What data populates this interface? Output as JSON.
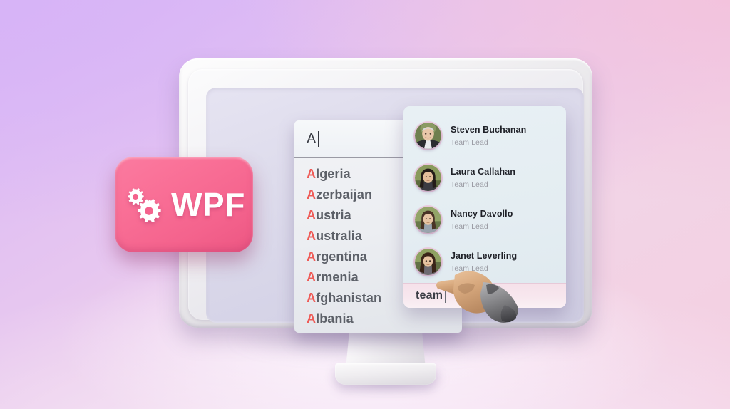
{
  "background": {
    "gradient_from": "#d9b6f6",
    "gradient_to": "#f4cfe1"
  },
  "badge": {
    "label": "WPF",
    "icon": "gears-icon",
    "color": "#f4638d",
    "text_color": "#ffffff"
  },
  "monitor": {
    "bezel_color": "#f2f1f3",
    "screen_color": "#dddbec"
  },
  "autocomplete": {
    "input": {
      "value": "A",
      "placeholder": "",
      "caret": true
    },
    "highlight_color": "#ef5b57",
    "items": [
      {
        "highlight": "A",
        "rest": "lgeria"
      },
      {
        "highlight": "A",
        "rest": "zerbaijan"
      },
      {
        "highlight": "A",
        "rest": "ustria"
      },
      {
        "highlight": "A",
        "rest": "ustralia"
      },
      {
        "highlight": "A",
        "rest": "rgentina"
      },
      {
        "highlight": "A",
        "rest": "rmenia"
      },
      {
        "highlight": "A",
        "rest": "fghanistan"
      },
      {
        "highlight": "A",
        "rest": "lbania"
      }
    ]
  },
  "people_panel": {
    "people": [
      {
        "name": "Steven Buchanan",
        "role": "Team Lead",
        "avatar": "avatar-steven"
      },
      {
        "name": "Laura Callahan",
        "role": "Team Lead",
        "avatar": "avatar-laura"
      },
      {
        "name": "Nancy Davollo",
        "role": "Team Lead",
        "avatar": "avatar-nancy"
      },
      {
        "name": "Janet Leverling",
        "role": "Team Lead",
        "avatar": "avatar-janet"
      }
    ],
    "search": {
      "value": "team",
      "placeholder": "",
      "caret": true,
      "background_color": "#f7e7ee"
    }
  },
  "cursor": {
    "type": "hand-pointer",
    "skin_color": "#d8a97f",
    "sleeve_color": "#8d8d8d"
  }
}
